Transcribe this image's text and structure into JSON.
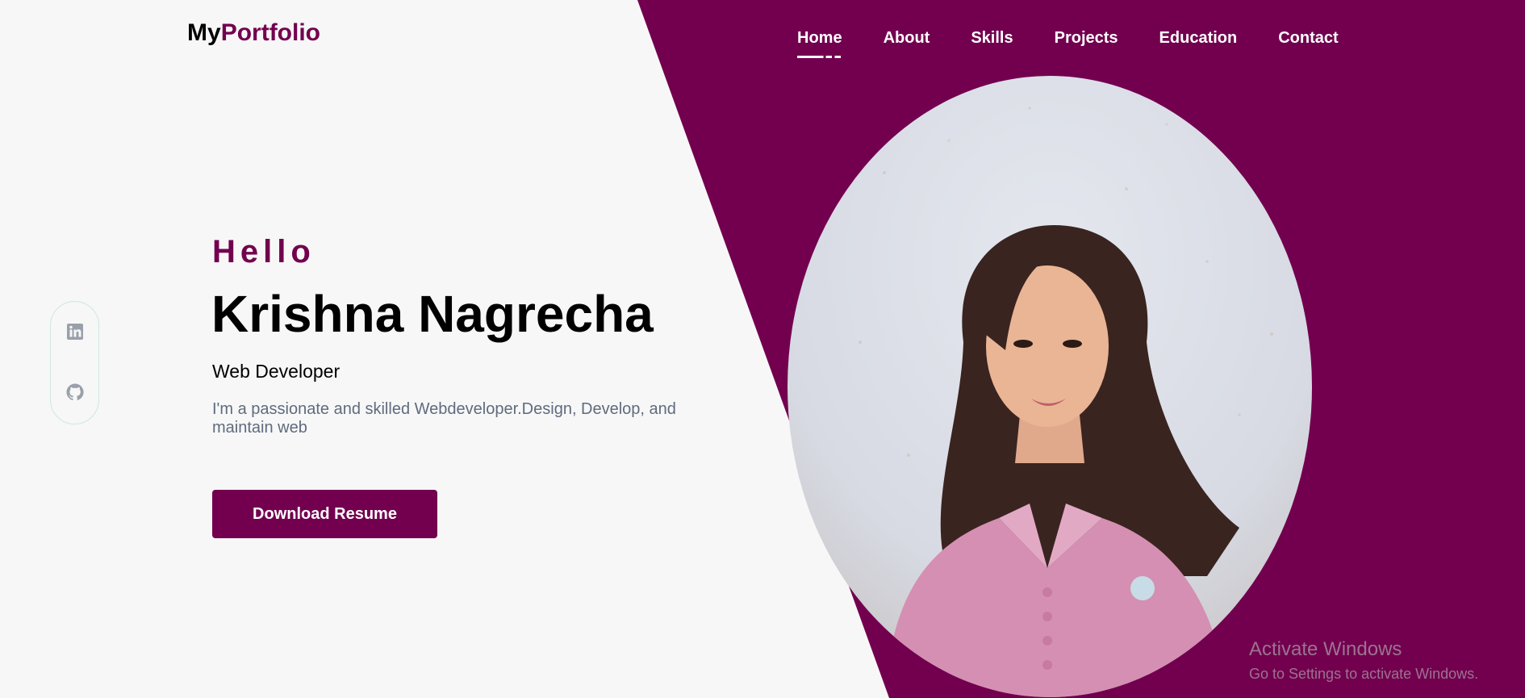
{
  "header": {
    "logo_prefix": "My",
    "logo_accent": "Portfolio"
  },
  "nav": {
    "items": [
      "Home",
      "About",
      "Skills",
      "Projects",
      "Education",
      "Contact"
    ],
    "active": "Home"
  },
  "social": {
    "icons": [
      "linkedin-icon",
      "github-icon"
    ]
  },
  "hero": {
    "greeting": "Hello",
    "name": "Krishna Nagrecha",
    "role": "Web Developer",
    "description": "I'm a passionate and skilled Webdeveloper.Design, Develop, and maintain web",
    "button_label": "Download Resume"
  },
  "watermark": {
    "title": "Activate Windows",
    "subtitle": "Go to Settings to activate Windows."
  },
  "colors": {
    "accent": "#72004f",
    "background": "#f7f7f7",
    "text_muted": "#5f6b7e",
    "social_border": "#cfe8de",
    "icon_gray": "#9aa0aa"
  }
}
